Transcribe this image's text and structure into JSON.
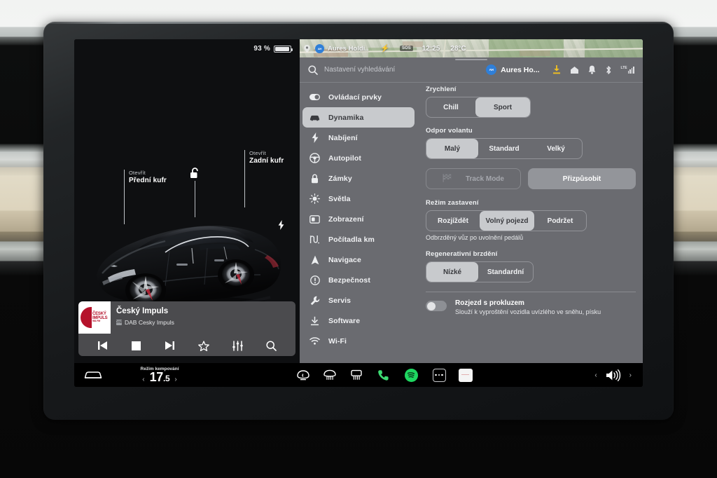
{
  "car_view": {
    "battery_percent": "93 %",
    "battery_level": 93,
    "callouts": [
      {
        "sub": "Otevřít",
        "main": "Přední kufr"
      },
      {
        "sub": "Otevřít",
        "main": "Zadní kufr"
      }
    ],
    "lock_icon": "unlocked-padlock-icon",
    "charge_icon": "charge-bolt-icon"
  },
  "media": {
    "title": "Český Impuls",
    "subtitle": "DAB Cesky Impuls",
    "badge": "DAB",
    "art_text_line1": "ČESKÝ",
    "art_text_line2": "IMPULS",
    "art_text_line3": "981 FM",
    "controls": [
      {
        "name": "previous-track-button",
        "icon": "skip-previous-icon"
      },
      {
        "name": "stop-button",
        "icon": "stop-icon"
      },
      {
        "name": "next-track-button",
        "icon": "skip-next-icon"
      },
      {
        "name": "favorite-button",
        "icon": "star-icon"
      },
      {
        "name": "equalizer-button",
        "icon": "sliders-icon"
      },
      {
        "name": "media-search-button",
        "icon": "search-icon"
      }
    ]
  },
  "map_strip": {
    "account": "Aures Holdi..",
    "sos": "SOS",
    "time": "12:25",
    "temperature": "28°C",
    "charger_icon": "charger-pin-icon",
    "nav_icon": "navigation-pin-icon"
  },
  "header": {
    "search_placeholder": "Nastavení vyhledávání",
    "profile_name": "Aures Ho...",
    "profile_initials": "AH",
    "status_icons": [
      {
        "name": "software-download-icon",
        "color": "#f0c020"
      },
      {
        "name": "home-icon",
        "color": "#e4e5e8"
      },
      {
        "name": "bell-icon",
        "color": "#e4e5e8"
      },
      {
        "name": "bluetooth-icon",
        "color": "#e4e5e8"
      },
      {
        "name": "lte-signal-icon",
        "color": "#e4e5e8"
      }
    ],
    "lte_label": "LTE"
  },
  "sidebar": {
    "items": [
      {
        "label": "Ovládací prvky",
        "icon": "toggle-switch-icon",
        "active": false
      },
      {
        "label": "Dynamika",
        "icon": "car-icon",
        "active": true
      },
      {
        "label": "Nabíjení",
        "icon": "bolt-icon",
        "active": false
      },
      {
        "label": "Autopilot",
        "icon": "steering-wheel-icon",
        "active": false
      },
      {
        "label": "Zámky",
        "icon": "lock-icon",
        "active": false
      },
      {
        "label": "Světla",
        "icon": "light-icon",
        "active": false
      },
      {
        "label": "Zobrazení",
        "icon": "display-icon",
        "active": false
      },
      {
        "label": "Počítadla km",
        "icon": "odometer-icon",
        "active": false
      },
      {
        "label": "Navigace",
        "icon": "navigation-arrow-icon",
        "active": false
      },
      {
        "label": "Bezpečnost",
        "icon": "alert-circle-icon",
        "active": false
      },
      {
        "label": "Servis",
        "icon": "wrench-icon",
        "active": false
      },
      {
        "label": "Software",
        "icon": "download-icon",
        "active": false
      },
      {
        "label": "Wi-Fi",
        "icon": "wifi-icon",
        "active": false
      }
    ]
  },
  "settings": {
    "acceleration": {
      "label": "Zrychlení",
      "options": [
        "Chill",
        "Sport"
      ],
      "selected": "Sport"
    },
    "steering": {
      "label": "Odpor volantu",
      "options": [
        "Malý",
        "Standard",
        "Velký"
      ],
      "selected": "Malý"
    },
    "track_mode": {
      "label": "Track Mode",
      "icon": "checkered-flag-icon",
      "enabled": false
    },
    "customize": {
      "label": "Přizpůsobit"
    },
    "stopping_mode": {
      "label": "Režim zastavení",
      "options": [
        "Rozjíždět",
        "Volný pojezd",
        "Podržet"
      ],
      "selected": "Volný pojezd",
      "hint": "Odbrzděný vůz po uvolnění pedálů"
    },
    "regen_braking": {
      "label": "Regenerativní brzdění",
      "options": [
        "Nízké",
        "Standardní"
      ],
      "selected": "Nízké"
    },
    "traction": {
      "title": "Rozjezd s prokluzem",
      "description": "Slouží k vyproštění vozidla uvízlého ve sněhu, písku",
      "enabled": false
    }
  },
  "bottom_bar": {
    "car_icon": "car-front-icon",
    "climate_mode": "Režim kempování",
    "temperature": "17",
    "temperature_decimal": ".5",
    "prev_arrow": "‹",
    "next_arrow": "›",
    "icons": [
      {
        "name": "front-defrost-icon"
      },
      {
        "name": "seat-heater-icon"
      },
      {
        "name": "rear-defrost-icon"
      },
      {
        "name": "phone-icon",
        "color": "#3ddc73"
      }
    ],
    "spotify": "spotify-icon",
    "more_apps": "more-apps-icon",
    "card_app": "card-app-icon",
    "volume_icon": "volume-icon"
  },
  "colors": {
    "panel_bg": "#6a6b70",
    "selected_seg": "#c8cacd",
    "accent_yellow": "#f0c020",
    "spotify_green": "#1ed760",
    "phone_green": "#3ddc73"
  }
}
